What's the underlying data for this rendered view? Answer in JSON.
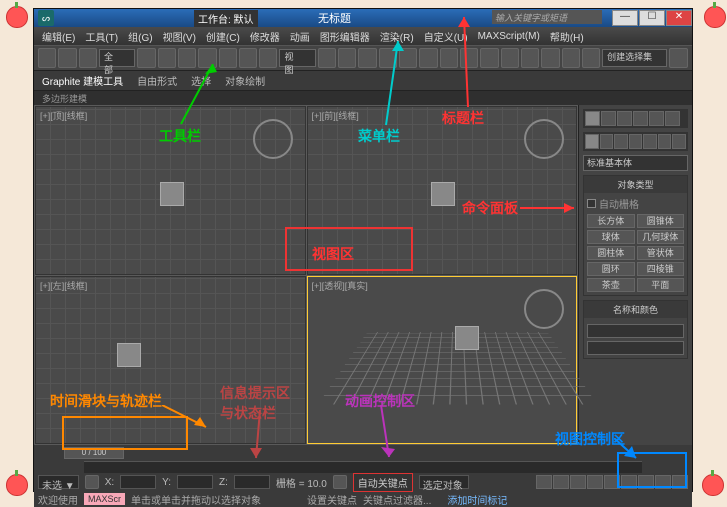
{
  "title": "无标题",
  "workspace": "工作台: 默认",
  "search_placeholder": "输入关键字或矩语",
  "menu": [
    "编辑(E)",
    "工具(T)",
    "组(G)",
    "视图(V)",
    "创建(C)",
    "修改器",
    "动画",
    "图形编辑器",
    "渲染(R)",
    "自定义(U)",
    "MAXScript(M)",
    "帮助(H)"
  ],
  "toolbar_combo": "全部",
  "toolbar_view": "视图",
  "toolbar_create": "创建选择集",
  "ribbon": {
    "tab1": "Graphite 建模工具",
    "tab2": "自由形式",
    "tab3": "选择",
    "tab4": "对象绘制"
  },
  "substrip": "多边形建模",
  "viewports": {
    "tl": "[+][顶][线框]",
    "tr": "[+][前][线框]",
    "bl": "[+][左][线框]",
    "br": "[+][透视][真实]"
  },
  "command": {
    "category": "标准基本体",
    "rollout1": "对象类型",
    "autogrid": "自动栅格",
    "objects": [
      "长方体",
      "圆锥体",
      "球体",
      "几何球体",
      "圆柱体",
      "管状体",
      "圆环",
      "四棱锥",
      "茶壶",
      "平面"
    ],
    "rollout2": "名称和颜色"
  },
  "time": {
    "frame": "0 / 100"
  },
  "status": {
    "none": "未选 ▼",
    "x": "X:",
    "y": "Y:",
    "z": "Z:",
    "grid": "栅格 = 10.0",
    "autokey": "自动关键点",
    "selected": "选定对象",
    "setkey": "设置关键点",
    "keyfilter": "关键点过滤器..."
  },
  "prompt": {
    "welcome": "欢迎使用",
    "script": "MAXScr",
    "hint": "单击或单击并拖动以选择对象",
    "addtime": "添加时间标记"
  },
  "annotations": {
    "toolbar": "工具栏",
    "menubar": "菜单栏",
    "titlebar": "标题栏",
    "cmdpanel": "命令面板",
    "viewport": "视图区",
    "timeslider": "时间滑块与轨迹栏",
    "info": "信息提示区\n与状态栏",
    "anim": "动画控制区",
    "viewnav": "视图控制区"
  }
}
